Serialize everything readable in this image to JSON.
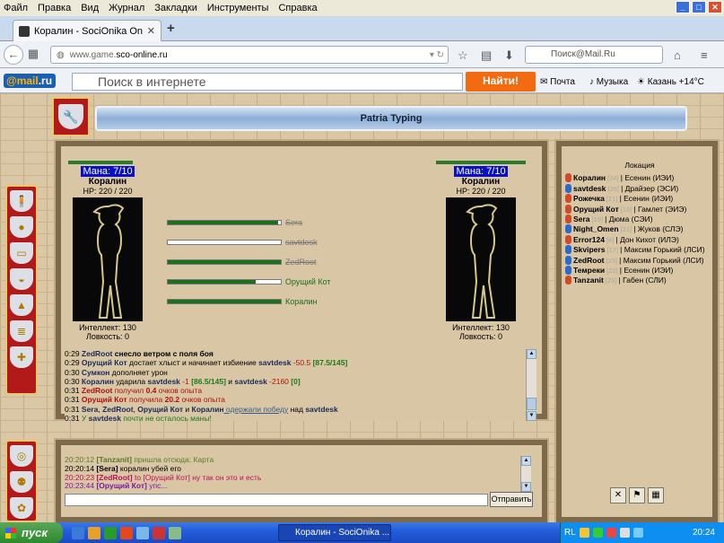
{
  "browser": {
    "menu": [
      "Файл",
      "Правка",
      "Вид",
      "Журнал",
      "Закладки",
      "Инструменты",
      "Справка"
    ],
    "tab_title": "Коралин - SociOnika Online",
    "url_prefix": "www.game.",
    "url_domain": "sco-online.ru",
    "search_placeholder": "Поиск@Mail.Ru"
  },
  "mailbar": {
    "logo_main": "@mail",
    "logo_suffix": ".ru",
    "search_placeholder": "Поиск в интернете",
    "find_button": "Найти!",
    "links": [
      "Почта",
      "Музыка",
      "Казань +14°C"
    ]
  },
  "game": {
    "title": "Patria Typing",
    "left_fighter": {
      "mana": "Мана: 7/10",
      "name": "Коралин",
      "hp": "HP: 220 / 220",
      "stat1": "Интеллект: 130",
      "stat2": "Ловкость: 0"
    },
    "right_fighter": {
      "mana": "Мана: 7/10",
      "name": "Коралин",
      "hp": "HP: 220 / 220",
      "stat1": "Интеллект: 130",
      "stat2": "Ловкость: 0"
    },
    "participants": [
      {
        "name": "Sera",
        "fill": 0.98,
        "status": "dead"
      },
      {
        "name": "savtdesk",
        "fill": 0.0,
        "status": "dead"
      },
      {
        "name": "ZedRoot",
        "fill": 1.0,
        "status": "dead"
      },
      {
        "name": "Орущий Кот",
        "fill": 0.78,
        "status": "alive"
      },
      {
        "name": "Коралин",
        "fill": 1.0,
        "status": "alive"
      }
    ],
    "combat_log": [
      {
        "t": "0:29",
        "parts": [
          [
            "ZedRoot",
            "n"
          ],
          [
            " снесло ветром с поля боя",
            "b"
          ]
        ]
      },
      {
        "t": "0:29",
        "parts": [
          [
            "Орущий Кот",
            "n"
          ],
          [
            " достает хлыст и начинает избиение ",
            ""
          ],
          [
            "savtdesk",
            "n"
          ],
          [
            " -50.5 ",
            "r"
          ],
          [
            "[87.5/145]",
            "g"
          ]
        ]
      },
      {
        "t": "0:30",
        "parts": [
          [
            "Сумкон",
            "n"
          ],
          [
            " дополняет урон",
            ""
          ]
        ]
      },
      {
        "t": "0:30",
        "parts": [
          [
            "Коралин",
            "n"
          ],
          [
            " ударила ",
            ""
          ],
          [
            "savtdesk",
            "n"
          ],
          [
            " -1 ",
            "r"
          ],
          [
            "[86.5/145]",
            "g"
          ],
          [
            " и ",
            ""
          ],
          [
            "savtdesk",
            "n"
          ],
          [
            " -2160 ",
            "r"
          ],
          [
            "[0]",
            "g"
          ]
        ]
      },
      {
        "t": "0:31",
        "parts": [
          [
            "ZedRoot",
            "rn"
          ],
          [
            " получил ",
            "r"
          ],
          [
            "0.4",
            "rn"
          ],
          [
            " очков опыта",
            "r"
          ]
        ]
      },
      {
        "t": "0:31",
        "parts": [
          [
            "Орущий Кот",
            "rn"
          ],
          [
            " получила ",
            "r"
          ],
          [
            "20.2",
            "rn"
          ],
          [
            " очков опыта",
            "r"
          ]
        ]
      },
      {
        "t": "0:31",
        "parts": [
          [
            "Sera",
            "n"
          ],
          [
            ", ",
            ""
          ],
          [
            "ZedRoot",
            "n"
          ],
          [
            ", ",
            ""
          ],
          [
            "Орущий Кот",
            "n"
          ],
          [
            " и ",
            ""
          ],
          [
            "Коралин",
            "n"
          ],
          [
            " одержали победу",
            "u"
          ],
          [
            " над ",
            ""
          ],
          [
            "savtdesk",
            "n"
          ]
        ]
      },
      {
        "t": "0:31",
        "parts": [
          [
            "У ",
            "gr"
          ],
          [
            "savtdesk",
            "n"
          ],
          [
            " почти не осталось маны!",
            "gr"
          ]
        ]
      }
    ],
    "chat": [
      {
        "t": "20:20:12",
        "user": "[Tanzanit]",
        "text": " пришла отсюда: Карта",
        "color": "#5a7a2a"
      },
      {
        "t": "20:20:14",
        "user": "[Sera]",
        "text": " коралин убей его",
        "color": "#000"
      },
      {
        "t": "20:20:23",
        "user": "[ZedRoot]",
        "text": " to [Орущий Кот] ну так он это и есть",
        "color": "#c0105a"
      },
      {
        "t": "20:23:44",
        "user": "[Орущий Кот]",
        "text": " упс...",
        "color": "#7a1aa0"
      }
    ],
    "send_button": "Отправить",
    "location_header": "Локация",
    "location_users": [
      {
        "name": "Коралин",
        "lvl": "[24]",
        "role": "| Есенин (ИЭИ)",
        "g": "#d04a2a"
      },
      {
        "name": "savtdesk",
        "lvl": "[26]",
        "role": "| Драйзер (ЭСИ)",
        "g": "#2a6ad0"
      },
      {
        "name": "Рожечка",
        "lvl": "[21]",
        "role": "| Есенин (ИЭИ)",
        "g": "#d04a2a"
      },
      {
        "name": "Орущий Кот",
        "lvl": "[18]",
        "role": "| Гамлет (ЭИЭ)",
        "g": "#d04a2a"
      },
      {
        "name": "Sera",
        "lvl": "[19]",
        "role": "| Дюма (СЭИ)",
        "g": "#d04a2a"
      },
      {
        "name": "Night_Omen",
        "lvl": "[21]",
        "role": "| Жуков (СЛЭ)",
        "g": "#2a6ad0"
      },
      {
        "name": "Error124",
        "lvl": "[8]",
        "role": "| Дон Кихот (ИЛЭ)",
        "g": "#d04a2a"
      },
      {
        "name": "Skvipers",
        "lvl": "[17]",
        "role": "| Максим Горький (ЛСИ)",
        "g": "#2a6ad0"
      },
      {
        "name": "ZedRoot",
        "lvl": "[23]",
        "role": "| Максим Горький (ЛСИ)",
        "g": "#2a6ad0"
      },
      {
        "name": "Темреки",
        "lvl": "[22]",
        "role": "| Есенин (ИЭИ)",
        "g": "#2a6ad0"
      },
      {
        "name": "Tanzanit",
        "lvl": "[23]",
        "role": "| Габен (СЛИ)",
        "g": "#d04a2a"
      }
    ]
  },
  "taskbar": {
    "start": "пуск",
    "task": "Коралин - SociOnika ...",
    "lang": "RL",
    "time": "20:24"
  }
}
